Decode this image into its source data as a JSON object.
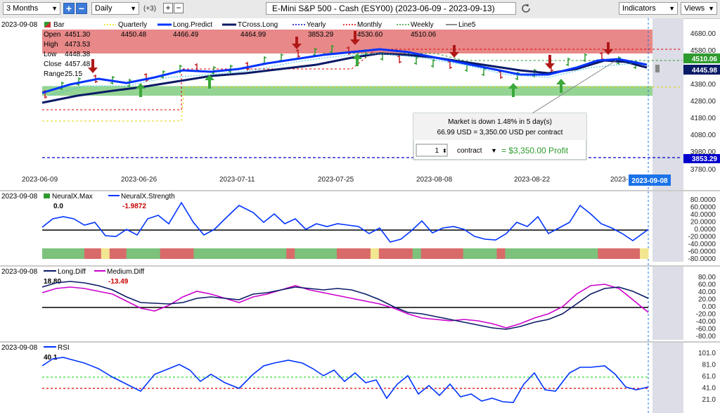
{
  "toolbar": {
    "period": "3 Months",
    "interval": "Daily",
    "plus_count": "(+3)",
    "title": "E-Mini S&P 500 - Cash (ESY00) (2023-06-09 - 2023-09-13)",
    "indicators_label": "Indicators",
    "views_label": "Views"
  },
  "price_panel": {
    "date": "2023-09-08",
    "legend": [
      {
        "name": "Bar",
        "color": "#2e9b2e",
        "value": ""
      },
      {
        "name": "Quarterly",
        "color": "#e8e800",
        "value": "4450.48"
      },
      {
        "name": "Long.Predict",
        "color": "#0033ff",
        "value": "4466.49"
      },
      {
        "name": "TCross.Long",
        "color": "#000066",
        "value": "4464.99"
      },
      {
        "name": "Yearly",
        "color": "#0000cc",
        "value": "3853.29"
      },
      {
        "name": "Monthly",
        "color": "#dd0000",
        "value": "4530.60"
      },
      {
        "name": "Weekly",
        "color": "#2e9b2e",
        "value": "4510.06"
      },
      {
        "name": "Line5",
        "color": "#666666",
        "value": ""
      }
    ],
    "ohlc": [
      {
        "label": "Open",
        "value": "4451.30"
      },
      {
        "label": "High",
        "value": "4473.53"
      },
      {
        "label": "Low",
        "value": "4448.38"
      },
      {
        "label": "Close",
        "value": "4457.48"
      },
      {
        "label": "Range",
        "value": "25.15"
      }
    ],
    "y_ticks": [
      "4680.00",
      "4580.00",
      "4480.00",
      "4380.00",
      "4280.00",
      "4180.00",
      "4080.00",
      "3980.00",
      "3780.00"
    ],
    "price_tags": [
      {
        "value": "4510.06",
        "bg": "#2e9b2e"
      },
      {
        "value": "4445.98",
        "bg": "#0a1a66"
      },
      {
        "value": "3853.29",
        "bg": "#0000cc"
      }
    ],
    "x_labels": [
      "2023-06-09",
      "2023-06-26",
      "2023-07-11",
      "2023-07-25",
      "2023-08-08",
      "2023-08-22",
      "2023-"
    ],
    "current_date_tag": "2023-09-08",
    "tooltip": {
      "line1": "Market is down 1.48% in 5 day(s)",
      "line2": "66.99 USD = 3,350.00 USD per contract",
      "qty": "1",
      "unit": "contract",
      "profit": "= $3,350.00 Profit"
    }
  },
  "neuralx_panel": {
    "date": "2023-09-08",
    "legend": [
      {
        "name": "NeuralX.Max",
        "color": "#2e9b2e",
        "value": "0.0",
        "value_color": "#000000"
      },
      {
        "name": "NeuralX.Strength",
        "color": "#0033ff",
        "value": "-1.9872",
        "value_color": "#cc0000"
      }
    ],
    "y_ticks": [
      "80.0000",
      "60.0000",
      "40.0000",
      "20.0000",
      "0.0000",
      "-20.0000",
      "-40.0000",
      "-60.0000",
      "-80.0000"
    ]
  },
  "diff_panel": {
    "date": "2023-09-08",
    "legend": [
      {
        "name": "Long.Diff",
        "color": "#0a1a66",
        "value": "18.80",
        "value_color": "#000000"
      },
      {
        "name": "Medium.Diff",
        "color": "#cc00cc",
        "value": "-13.49",
        "value_color": "#cc0000"
      }
    ],
    "y_ticks": [
      "80.00",
      "60.00",
      "40.00",
      "20.00",
      "0.00",
      "-20.00",
      "-40.00",
      "-60.00",
      "-80.00"
    ]
  },
  "rsi_panel": {
    "date": "2023-09-08",
    "legend": [
      {
        "name": "RSI",
        "color": "#0033ff",
        "value": "40.1",
        "value_color": "#000000"
      }
    ],
    "y_ticks": [
      "101.0",
      "81.0",
      "61.0",
      "41.0",
      "21.0"
    ]
  },
  "colors": {
    "long_predict": "#0033ff",
    "tcross_long": "#0a1a66",
    "bull_zone": "#8fd18f",
    "bear_zone": "#e07a7a",
    "medium_diff": "#cc00cc"
  }
}
